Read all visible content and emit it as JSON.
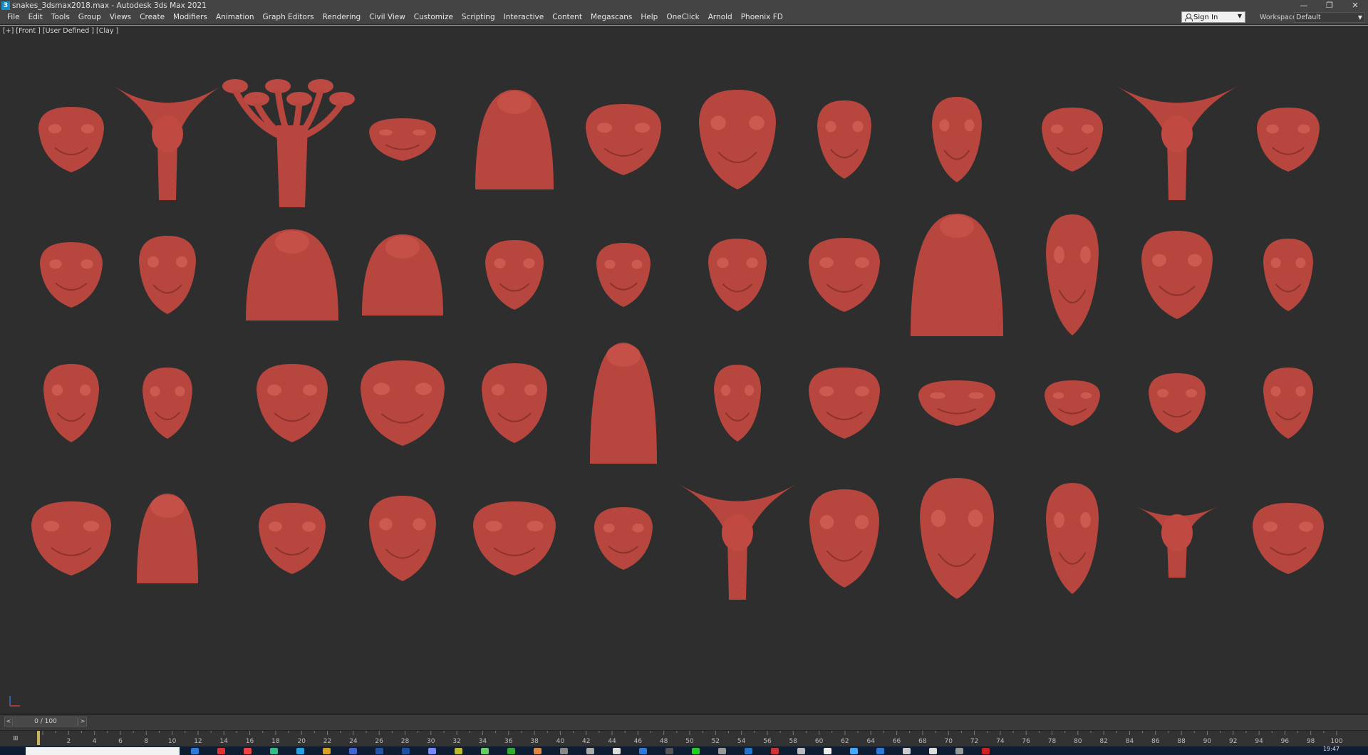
{
  "window": {
    "title": "snakes_3dsmax2018.max - Autodesk 3ds Max 2021",
    "app_icon": "3",
    "controls": {
      "minimize": "—",
      "restore": "❐",
      "close": "✕"
    }
  },
  "menubar": {
    "items": [
      "File",
      "Edit",
      "Tools",
      "Group",
      "Views",
      "Create",
      "Modifiers",
      "Animation",
      "Graph Editors",
      "Rendering",
      "Civil View",
      "Customize",
      "Scripting",
      "Interactive",
      "Content",
      "Megascans",
      "Help",
      "OneClick",
      "Arnold",
      "Phoenix FD"
    ],
    "signin_label": "Sign In",
    "workspaces_label": "Workspaces:",
    "workspace_value": "Default"
  },
  "viewport": {
    "label": "[+] [Front ] [User Defined ] [Clay ]",
    "model_color": "#b7463e",
    "background_color": "#2e2e2e"
  },
  "timeslider": {
    "value": "0 / 100",
    "prev": "<",
    "next": ">"
  },
  "trackbar": {
    "icon_label": "⊞",
    "ticks": [
      "2",
      "4",
      "6",
      "8",
      "10",
      "12",
      "14",
      "16",
      "18",
      "20",
      "22",
      "24",
      "26",
      "28",
      "30",
      "32",
      "34",
      "36",
      "38",
      "40",
      "42",
      "44",
      "46",
      "48",
      "50",
      "52",
      "54",
      "56",
      "58",
      "60",
      "62",
      "64",
      "66",
      "68",
      "70",
      "72",
      "74",
      "76",
      "78",
      "80",
      "82",
      "84",
      "86",
      "88",
      "90",
      "92",
      "94",
      "96",
      "98",
      "100"
    ]
  },
  "taskbar": {
    "clock": "19:47",
    "icon_colors": [
      "#2d7bd6",
      "#d33",
      "#e44",
      "#3b8",
      "#2aa0e0",
      "#d8a020",
      "#4466cc",
      "#2255aa",
      "#1f4fa0",
      "#7788ff",
      "#bb3",
      "#6c6",
      "#3a3",
      "#d84",
      "#888",
      "#aaa",
      "#ddd",
      "#2d7bd6",
      "#555",
      "#2c2",
      "#999",
      "#27c",
      "#c33",
      "#bbb",
      "#eee",
      "#4af",
      "#2d7bd6",
      "#ccc",
      "#ddd",
      "#999",
      "#c22"
    ]
  }
}
